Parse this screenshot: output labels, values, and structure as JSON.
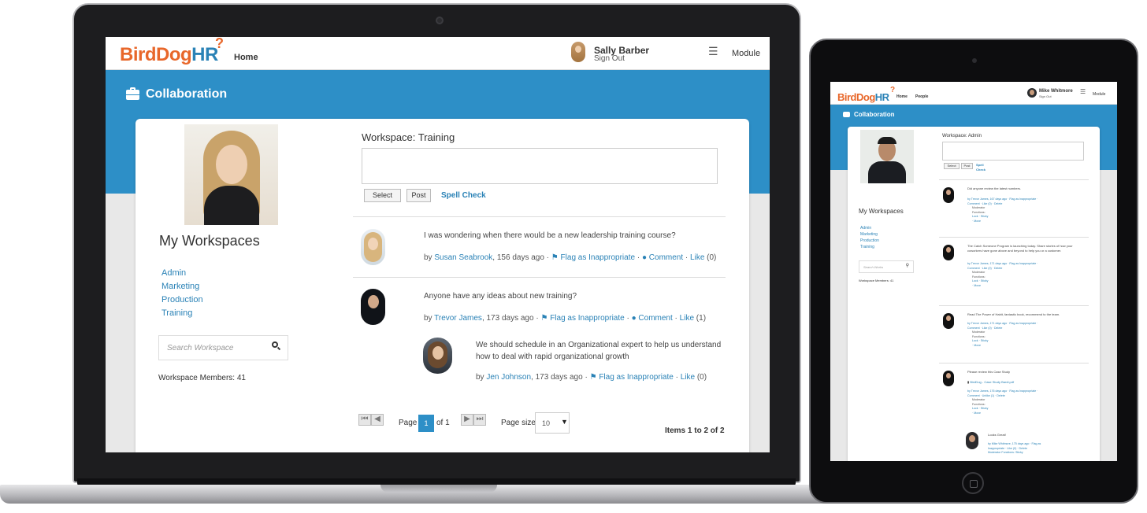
{
  "laptop": {
    "logo": {
      "part1": "BirdDog",
      "part2": "HR"
    },
    "nav": {
      "home": "Home",
      "module": "Module"
    },
    "user": {
      "name": "Sally Barber",
      "sign_out": "Sign Out"
    },
    "banner_title": "Collaboration",
    "sidebar": {
      "heading": "My Workspaces",
      "workspaces": [
        "Admin",
        "Marketing",
        "Production",
        "Training"
      ],
      "search_placeholder": "Search Workspace",
      "members": "Workspace Members: 41"
    },
    "workspace_title": "Workspace: Training",
    "buttons": {
      "select": "Select",
      "post": "Post",
      "spell_check": "Spell Check"
    },
    "posts": [
      {
        "text": "I was wondering when there would be a new leadership training course?",
        "by": "by ",
        "author": "Susan Seabrook",
        "age": ", 156 days ago · ",
        "flag": "Flag as Inappropriate",
        "sep1": " · ",
        "comment": "Comment",
        "sep2": " · ",
        "like": "Like",
        "count": " (0)"
      },
      {
        "text": "Anyone have any ideas about new training?",
        "by": "by ",
        "author": "Trevor James",
        "age": ", 173 days ago · ",
        "flag": "Flag as Inappropriate",
        "sep1": " · ",
        "comment": "Comment",
        "sep2": " · ",
        "like": "Like",
        "count": " (1)"
      }
    ],
    "reply": {
      "text": "We should schedule in an Organizational expert to help us understand how to deal with rapid organizational growth",
      "by": "by ",
      "author": "Jen Johnson",
      "age": ", 173 days ago · ",
      "flag": "Flag as Inappropriate",
      "sep": " · ",
      "like": "Like",
      "count": " (0)"
    },
    "pager": {
      "page_label": "Page",
      "current_page": "1",
      "of": "of 1",
      "size_label": "Page size",
      "size": "10",
      "items": "Items 1 to 2 of 2"
    }
  },
  "tablet": {
    "logo": {
      "part1": "BirdDog",
      "part2": "HR"
    },
    "nav": {
      "home": "Home",
      "people": "People",
      "module": "Module"
    },
    "user": {
      "name": "Mike Whitmore",
      "sign_out": "Sign Out"
    },
    "banner_title": "Collaboration",
    "sidebar": {
      "heading": "My Workspaces",
      "workspaces": [
        "Admin",
        "Marketing",
        "Production",
        "Training"
      ],
      "search_placeholder": "Search Works",
      "members": "Workspace Members: 41"
    },
    "workspace_title": "Workspace: Admin",
    "buttons": {
      "select": "Select",
      "post": "Post",
      "spell": "Spell",
      "check": "Check"
    },
    "posts": [
      {
        "text": "Did anyone review the latest numbers.",
        "meta1": "by Trevor James, 167 days ago · Flag as Inappropriate ·",
        "meta2": "Comment · Like (0) · Delete",
        "mod1": "Moderator",
        "mod2": "Functions:",
        "mod3": "Lock · Sticky",
        "mod4": "· Move"
      },
      {
        "text": "The Catch Someone Program is launching today. Share stories of how your coworkers have gone above and beyond to help you or a customer.",
        "meta1": "by Trevor James, 171 days ago · Flag as Inappropriate ·",
        "meta2": "Comment · Like (0) · Delete",
        "mod1": "Moderator",
        "mod2": "Functions:",
        "mod3": "Lock · Sticky",
        "mod4": "· Move"
      },
      {
        "text": "Read The Power of Habit, fantastic book, recommend to the team.",
        "meta1": "by Trevor James, 171 days ago · Flag as Inappropriate ·",
        "meta2": "Comment · Like (0) · Delete",
        "mod1": "Moderator",
        "mod2": "Functions:",
        "mod3": "Lock · Sticky",
        "mod4": "· Move"
      },
      {
        "text": "Please review this Case Study",
        "file": "BirdDog - Case Study Bardi.pdf",
        "meta1": "by Trevor James, 176 days ago · Flag as Inappropriate ·",
        "meta2": "Comment · Unlike (1) · Delete",
        "mod1": "Moderator",
        "mod2": "Functions:",
        "mod3": "Lock · Sticky",
        "mod4": "· Move"
      }
    ],
    "reply": {
      "text": "Looks Great!",
      "meta1": "by Mike Whitmore, 175 days ago · Flag as",
      "meta2": "Inappropriate · Like (0) · Delete",
      "meta3": "Moderator Functions: Sticky"
    }
  },
  "colors": {
    "brand_blue": "#2d8fc7",
    "brand_orange": "#e8672a",
    "link": "#2a82b6"
  }
}
